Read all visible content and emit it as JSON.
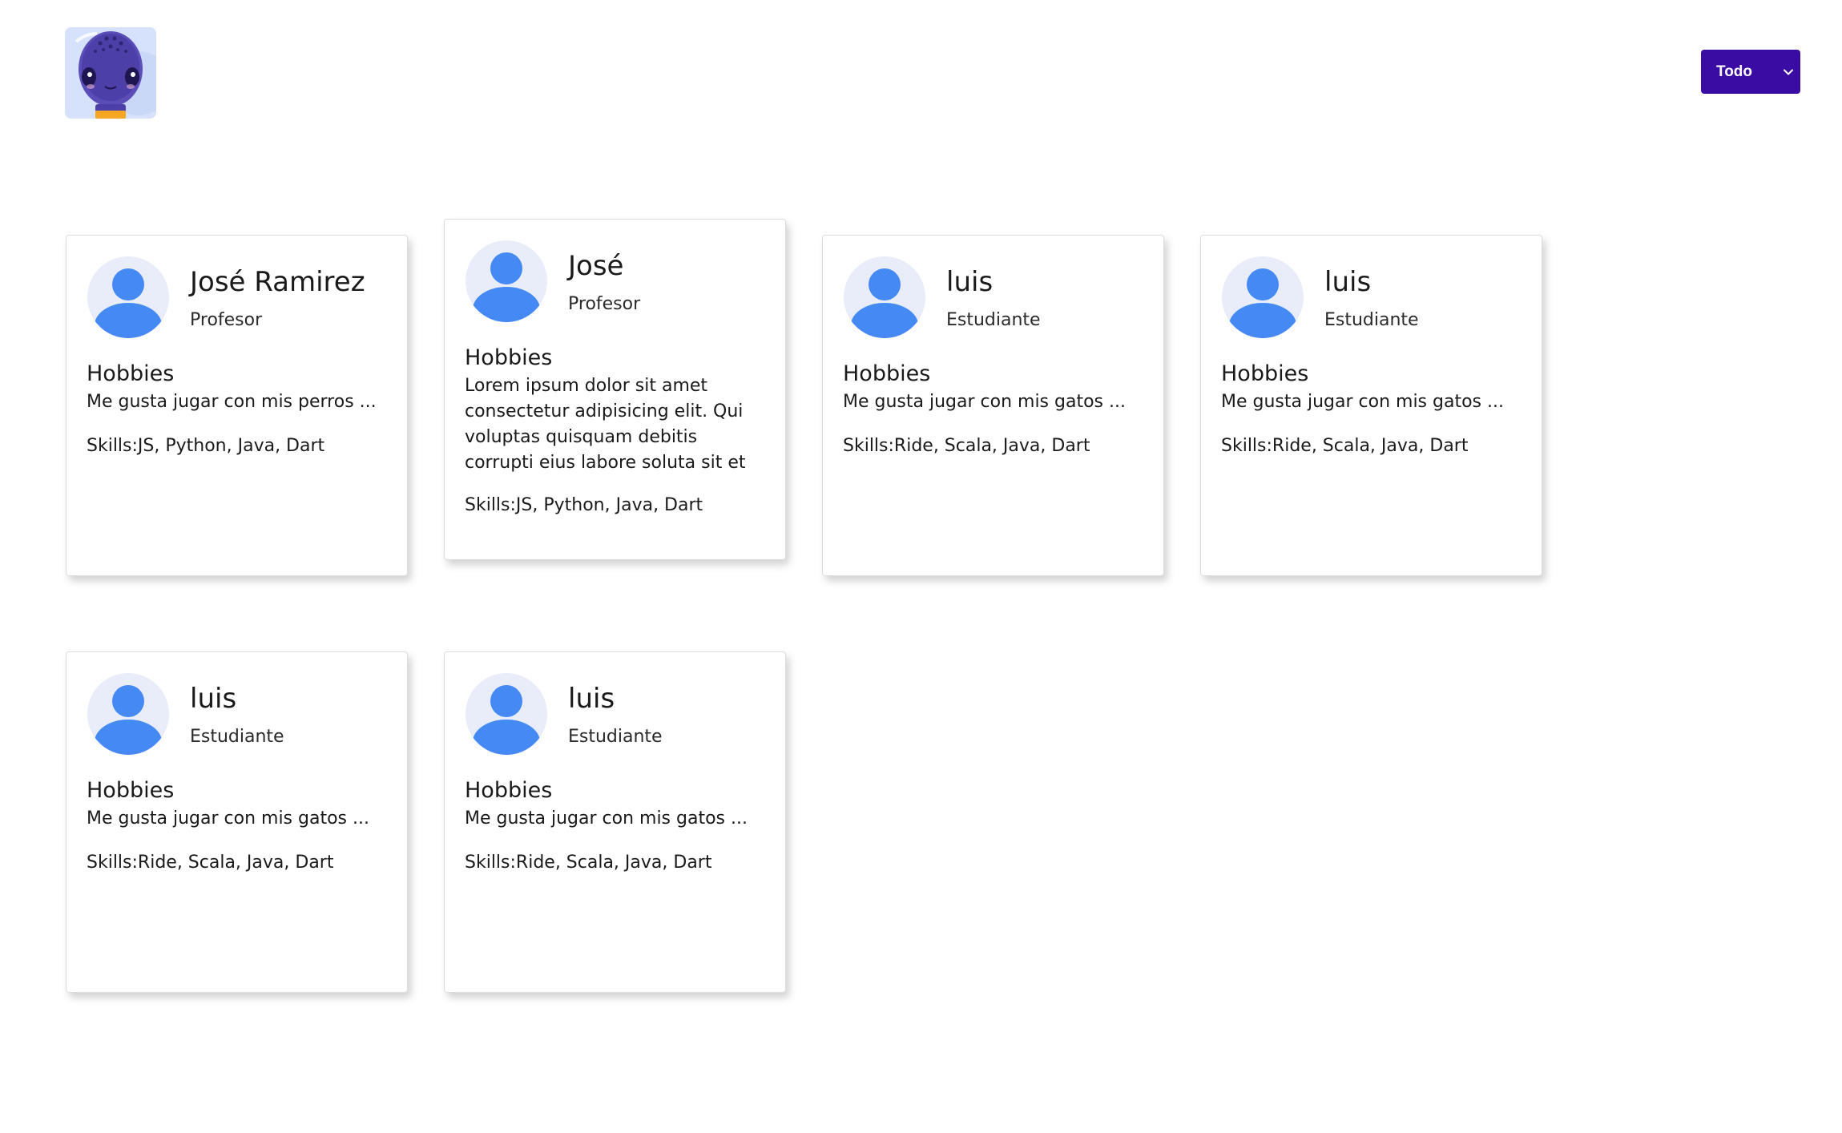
{
  "header": {
    "logo_icon": "alien-avatar-icon",
    "filter": {
      "selected": "Todo",
      "chevron_icon": "chevron-down-icon"
    }
  },
  "colors": {
    "accent": "#3a0ca3",
    "avatar_bg": "#e8edf9",
    "avatar_figure": "#4589f5"
  },
  "cards": [
    {
      "avatar_icon": "user-avatar-icon",
      "name": "José Ramirez",
      "role": "Profesor",
      "hobbies_heading": "Hobbies",
      "hobbies_text": "Me gusta jugar con mis perros ...",
      "skills": "Skills:JS, Python, Java, Dart"
    },
    {
      "avatar_icon": "user-avatar-icon",
      "name": "José",
      "role": "Profesor",
      "hobbies_heading": "Hobbies",
      "hobbies_text": "Lorem ipsum dolor sit amet consectetur adipisicing elit. Qui voluptas quisquam debitis corrupti eius labore soluta sit et earum suscipit.Lorem ipsum dolor sit",
      "skills": "Skills:JS, Python, Java, Dart"
    },
    {
      "avatar_icon": "user-avatar-icon",
      "name": "luis",
      "role": "Estudiante",
      "hobbies_heading": "Hobbies",
      "hobbies_text": "Me gusta jugar con mis gatos ...",
      "skills": "Skills:Ride, Scala, Java, Dart"
    },
    {
      "avatar_icon": "user-avatar-icon",
      "name": "luis",
      "role": "Estudiante",
      "hobbies_heading": "Hobbies",
      "hobbies_text": "Me gusta jugar con mis gatos ...",
      "skills": "Skills:Ride, Scala, Java, Dart"
    },
    {
      "avatar_icon": "user-avatar-icon",
      "name": "luis",
      "role": "Estudiante",
      "hobbies_heading": "Hobbies",
      "hobbies_text": "Me gusta jugar con mis gatos ...",
      "skills": "Skills:Ride, Scala, Java, Dart"
    },
    {
      "avatar_icon": "user-avatar-icon",
      "name": "luis",
      "role": "Estudiante",
      "hobbies_heading": "Hobbies",
      "hobbies_text": "Me gusta jugar con mis gatos ...",
      "skills": "Skills:Ride, Scala, Java, Dart"
    }
  ]
}
